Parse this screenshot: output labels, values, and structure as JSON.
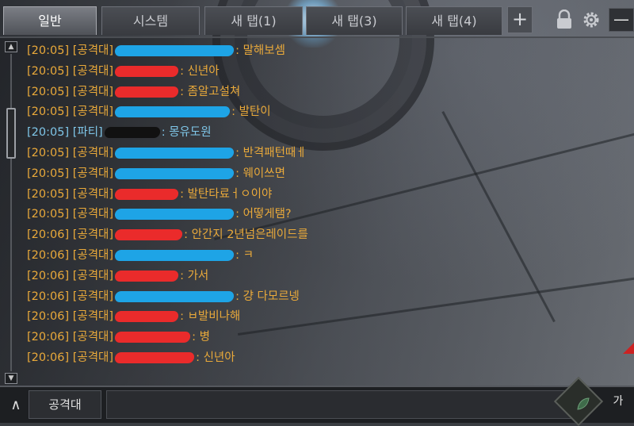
{
  "tabs": [
    {
      "label": "일반",
      "active": true
    },
    {
      "label": "시스템",
      "active": false
    },
    {
      "label": "새 탭(1)",
      "active": false
    },
    {
      "label": "새 탭(3)",
      "active": false
    },
    {
      "label": "새 탭(4)",
      "active": false
    }
  ],
  "toolbar": {
    "add_tab_label": "+",
    "minimize_label": "—",
    "lock_icon": "lock-icon",
    "settings_icon": "gear-icon"
  },
  "colors": {
    "raid_channel": "#e9a93a",
    "party_channel": "#7fc6e8",
    "redact_blue": "#1ea4e6",
    "redact_red": "#ea2b2b"
  },
  "messages": [
    {
      "time": "[20:05]",
      "channel": "[공격대]",
      "redact": "blue",
      "text": "말해보셈",
      "type": "raid"
    },
    {
      "time": "[20:05]",
      "channel": "[공격대]",
      "redact": "red",
      "text": "신년아",
      "type": "raid"
    },
    {
      "time": "[20:05]",
      "channel": "[공격대]",
      "redact": "red",
      "text": "좀알고설쳐",
      "type": "raid"
    },
    {
      "time": "[20:05]",
      "channel": "[공격대]",
      "redact": "blue",
      "text": "발탄이",
      "type": "raid"
    },
    {
      "time": "[20:05]",
      "channel": "[파티]",
      "redact": "black",
      "text": "몽유도원",
      "type": "party"
    },
    {
      "time": "[20:05]",
      "channel": "[공격대]",
      "redact": "blue",
      "text": "반격패턴때ㅔ",
      "type": "raid"
    },
    {
      "time": "[20:05]",
      "channel": "[공격대]",
      "redact": "blue",
      "text": "웨이쓰면",
      "type": "raid"
    },
    {
      "time": "[20:05]",
      "channel": "[공격대]",
      "redact": "red",
      "text": "발탄타료ㅓㅇ이야",
      "type": "raid"
    },
    {
      "time": "[20:05]",
      "channel": "[공격대]",
      "redact": "blue",
      "text": "어떻게탬?",
      "type": "raid"
    },
    {
      "time": "[20:06]",
      "channel": "[공격대]",
      "redact": "red",
      "text": "안간지 2년넘은레이드를",
      "type": "raid"
    },
    {
      "time": "[20:06]",
      "channel": "[공격대]",
      "redact": "blue",
      "text": "ㅋ",
      "type": "raid"
    },
    {
      "time": "[20:06]",
      "channel": "[공격대]",
      "redact": "red",
      "text": "가서",
      "type": "raid"
    },
    {
      "time": "[20:06]",
      "channel": "[공격대]",
      "redact": "blue",
      "text": "걍 다모르넹",
      "type": "raid"
    },
    {
      "time": "[20:06]",
      "channel": "[공격대]",
      "redact": "red",
      "text": "ㅂ발비나해",
      "type": "raid"
    },
    {
      "time": "[20:06]",
      "channel": "[공격대]",
      "redact": "red",
      "text": "병",
      "type": "raid"
    },
    {
      "time": "[20:06]",
      "channel": "[공격대]",
      "redact": "red",
      "text": "신년아",
      "type": "raid"
    }
  ],
  "input_bar": {
    "expand_label": "∧",
    "channel": "공격대",
    "ime": "가"
  }
}
